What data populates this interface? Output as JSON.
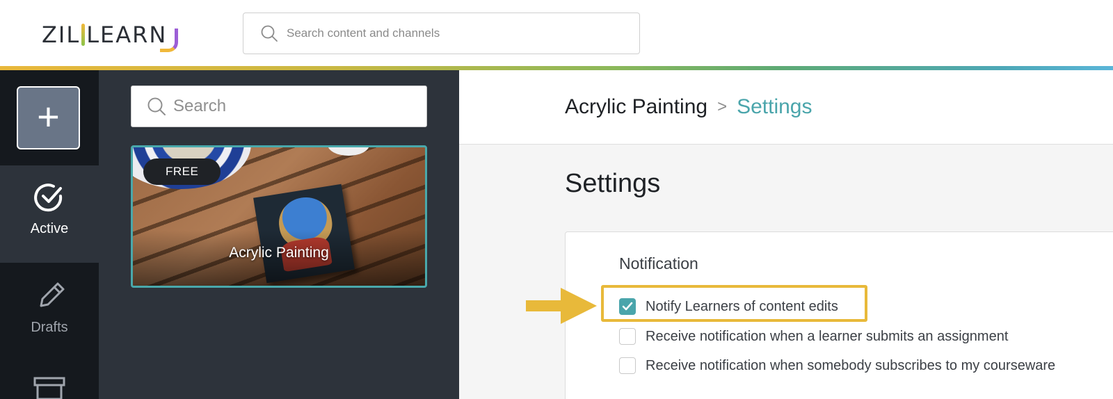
{
  "header": {
    "logo_text_left": "ZIL",
    "logo_text_right": "LEARN",
    "search_placeholder": "Search content and channels"
  },
  "rail": {
    "add_label": "+",
    "items": [
      {
        "label": "Active",
        "icon": "check-circle-icon"
      },
      {
        "label": "Drafts",
        "icon": "pencil-icon"
      },
      {
        "label": "",
        "icon": "archive-box-icon"
      }
    ]
  },
  "panel": {
    "search_placeholder": "Search",
    "cards": [
      {
        "badge": "FREE",
        "title": "Acrylic Painting"
      }
    ]
  },
  "main": {
    "breadcrumb": {
      "parent": "Acrylic Painting",
      "separator": ">",
      "current": "Settings"
    },
    "title": "Settings",
    "notification": {
      "heading": "Notification",
      "options": [
        {
          "label": "Notify Learners of content edits",
          "checked": true
        },
        {
          "label": "Receive notification when a learner submits an assignment",
          "checked": false
        },
        {
          "label": "Receive notification when somebody subscribes to my courseware",
          "checked": false
        }
      ]
    }
  },
  "colors": {
    "accent": "#4aa5ab",
    "highlight": "#e8b93a",
    "rail_bg": "#1f242b",
    "panel_bg": "#2d333b"
  }
}
